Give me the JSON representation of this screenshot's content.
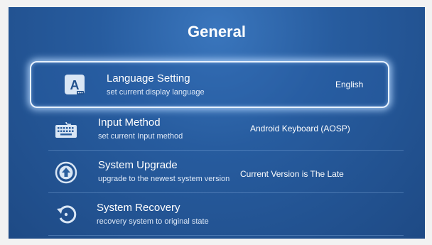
{
  "page": {
    "title": "General"
  },
  "rows": [
    {
      "label": "Language Setting",
      "sublabel": "set current display language",
      "value": "English",
      "icon": "language-icon"
    },
    {
      "label": "Input Method",
      "sublabel": "set current Input method",
      "value": "Android Keyboard (AOSP)",
      "icon": "keyboard-icon"
    },
    {
      "label": "System Upgrade",
      "sublabel": "upgrade to the newest system version",
      "value": "Current Version is The Late",
      "icon": "upgrade-icon"
    },
    {
      "label": "System Recovery",
      "sublabel": "recovery system to original state",
      "value": "",
      "icon": "recovery-icon"
    }
  ],
  "colors": {
    "background": "#275c9f",
    "selected_border": "#e8f2ff",
    "text": "#ffffff"
  }
}
